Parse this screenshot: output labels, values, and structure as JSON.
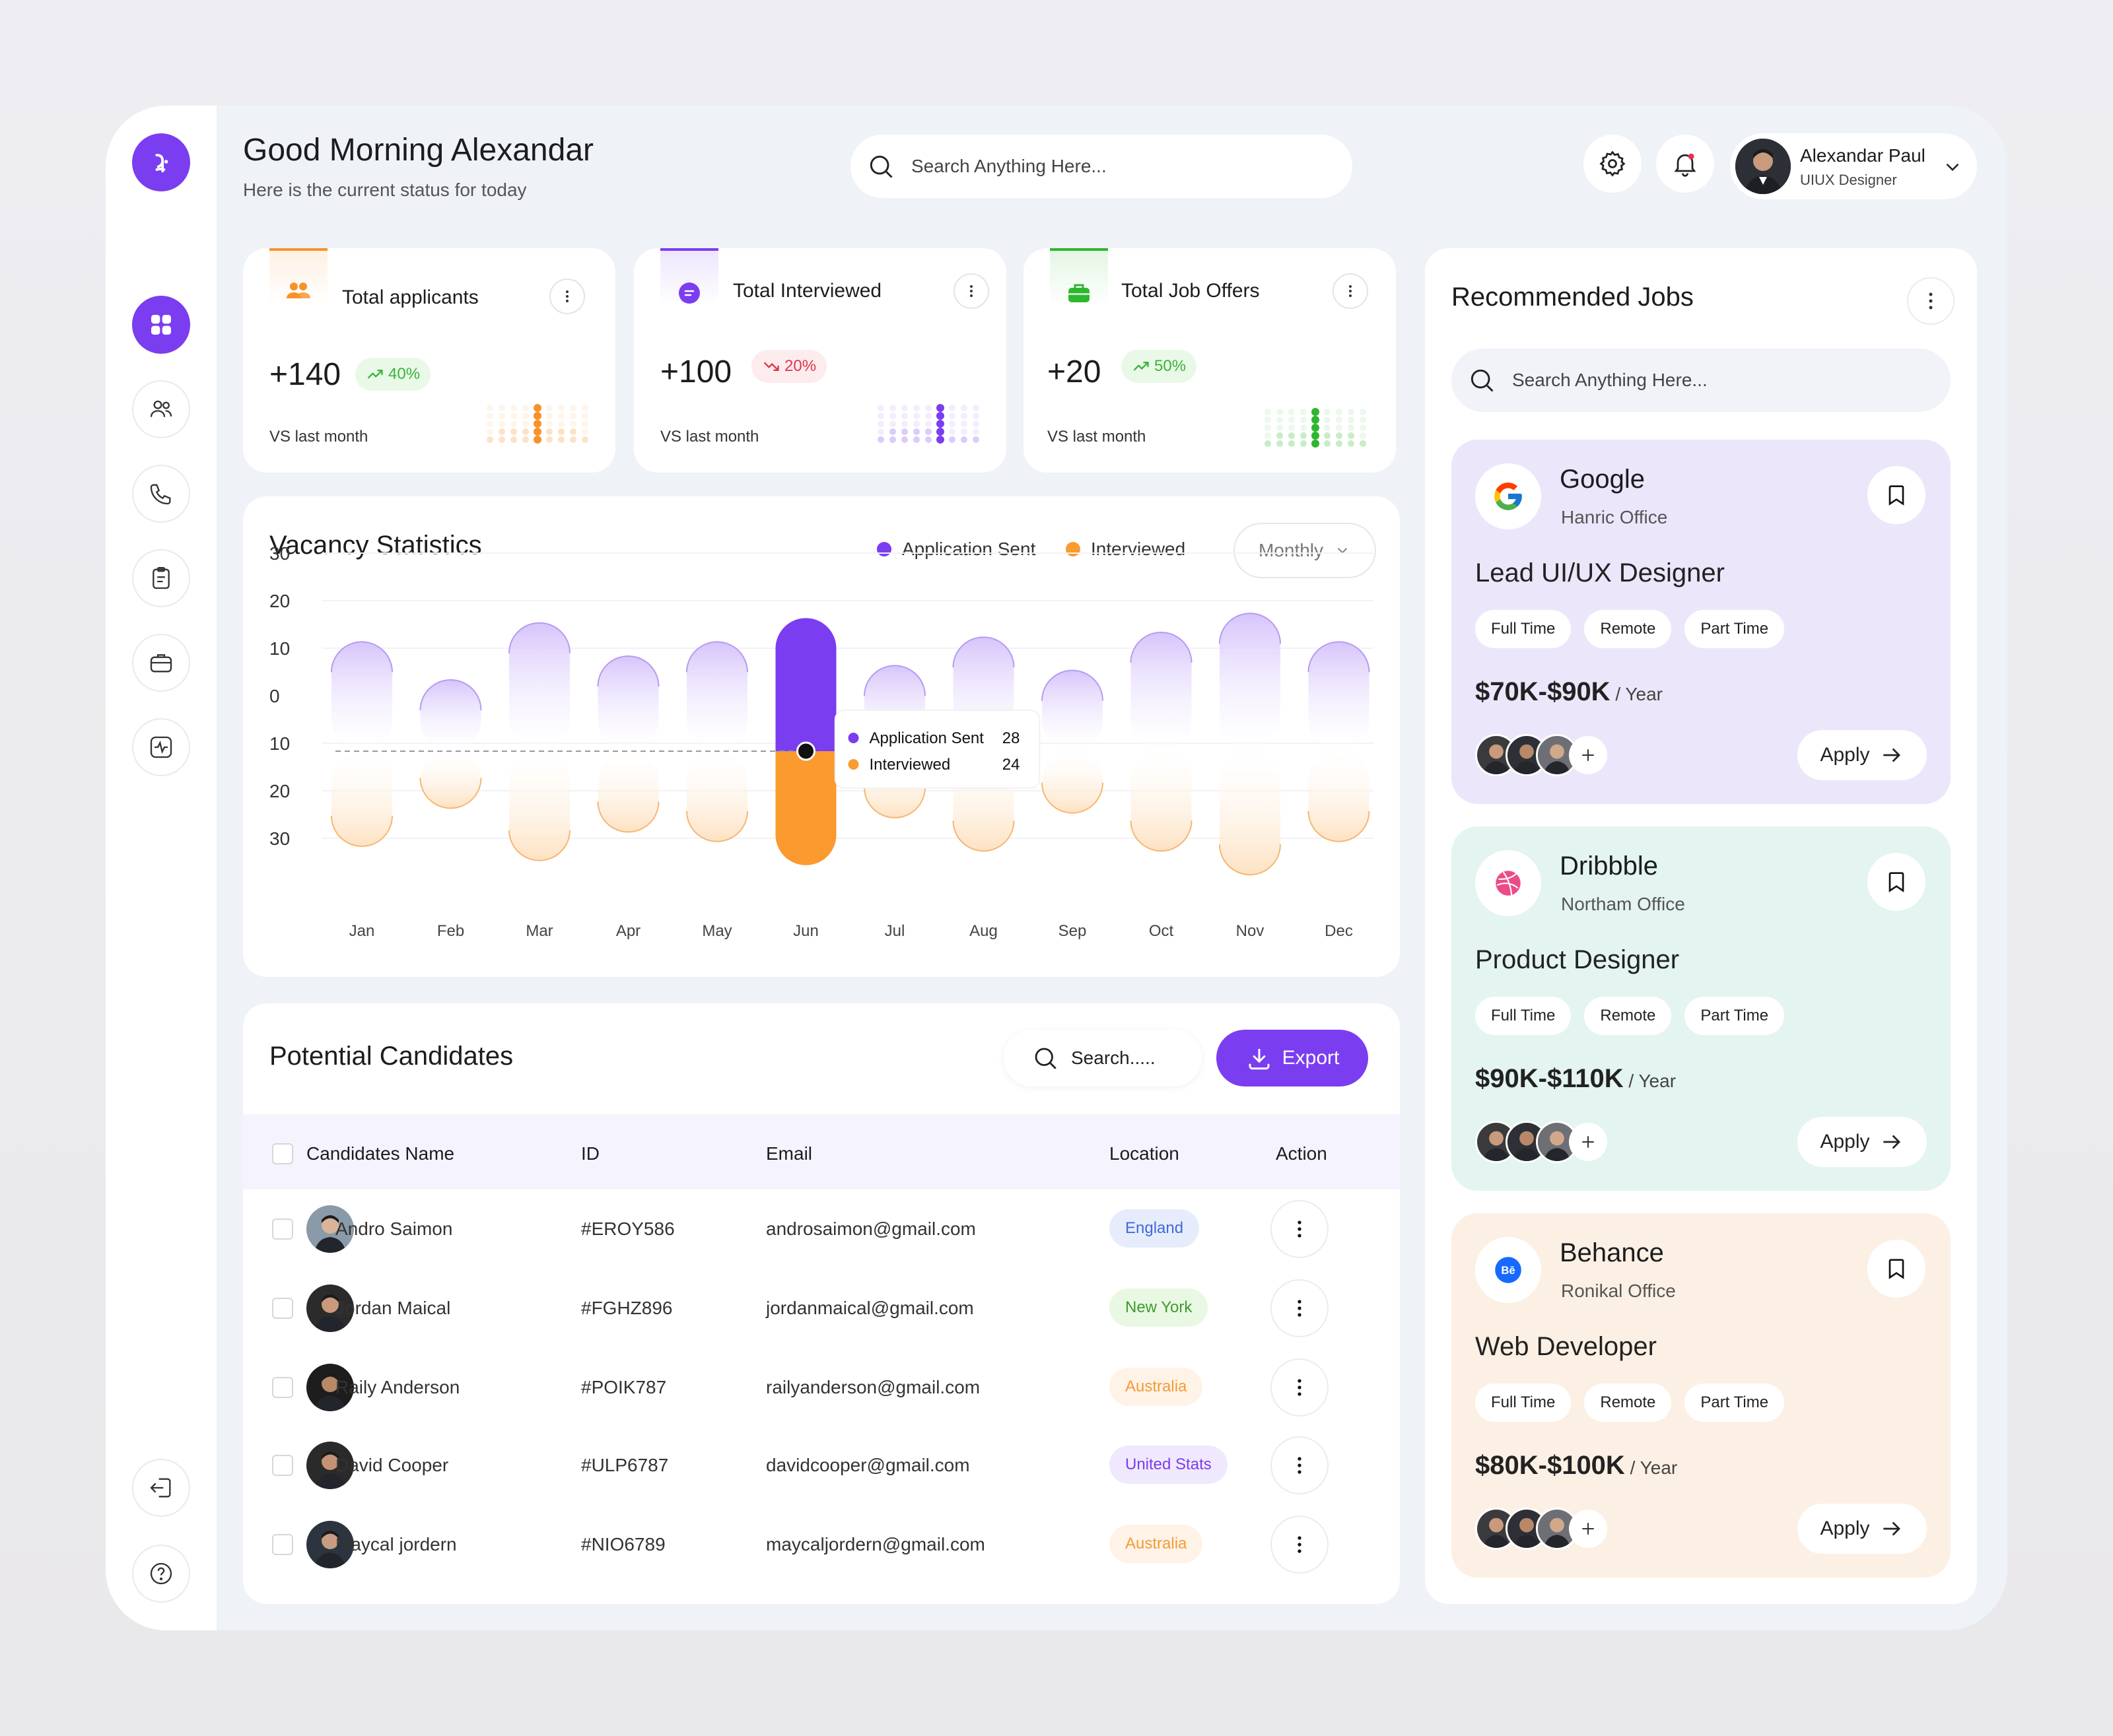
{
  "header": {
    "greeting": "Good Morning Alexandar",
    "subtitle": "Here is the current status for today",
    "search_placeholder": "Search Anything Here...",
    "user_name": "Alexandar Paul",
    "user_role": "UIUX Designer"
  },
  "sidebar": {
    "items": [
      {
        "icon": "dashboard-icon",
        "active": true
      },
      {
        "icon": "users-icon",
        "active": false
      },
      {
        "icon": "phone-icon",
        "active": false
      },
      {
        "icon": "clipboard-icon",
        "active": false
      },
      {
        "icon": "briefcase-icon",
        "active": false
      },
      {
        "icon": "activity-icon",
        "active": false
      }
    ],
    "bottom": [
      {
        "icon": "logout-icon"
      },
      {
        "icon": "help-icon"
      }
    ]
  },
  "stats": [
    {
      "label": "Total applicants",
      "value": "+140",
      "change": "40%",
      "trend": "up",
      "foot": "VS last month",
      "color": "#f7922a",
      "icon": "users-icon"
    },
    {
      "label": "Total Interviewed",
      "value": "+100",
      "change": "20%",
      "trend": "down",
      "foot": "VS last month",
      "color": "#7b3df0",
      "icon": "chat-icon"
    },
    {
      "label": "Total Job Offers",
      "value": "+20",
      "change": "50%",
      "trend": "up",
      "foot": "VS last month",
      "color": "#2fb62f",
      "icon": "briefcase-icon"
    }
  ],
  "vacancy": {
    "title": "Vacancy Statistics",
    "legend_sent": "Application Sent",
    "legend_interviewed": "Interviewed",
    "period": "Monthly",
    "tooltip": {
      "sent_label": "Application Sent",
      "sent_value": "28",
      "interviewed_label": "Interviewed",
      "interviewed_value": "24"
    }
  },
  "chart_data": {
    "type": "bar",
    "title": "Vacancy Statistics",
    "categories": [
      "Jan",
      "Feb",
      "Mar",
      "Apr",
      "May",
      "Jun",
      "Jul",
      "Aug",
      "Sep",
      "Oct",
      "Nov",
      "Dec"
    ],
    "y_ticks": [
      "30",
      "20",
      "10",
      "0",
      "10",
      "20",
      "30"
    ],
    "ylim": [
      -30,
      30
    ],
    "highlight_index": 5,
    "series": [
      {
        "name": "Application Sent",
        "color": "#7b3df0",
        "direction": "up",
        "values": [
          23,
          15,
          27,
          20,
          23,
          28,
          18,
          24,
          17,
          25,
          29,
          23
        ]
      },
      {
        "name": "Interviewed",
        "color": "#fb9a2f",
        "direction": "down",
        "values": [
          20,
          12,
          23,
          17,
          19,
          24,
          14,
          21,
          13,
          21,
          26,
          19
        ]
      }
    ]
  },
  "candidates": {
    "title": "Potential Candidates",
    "search_label": "Search.....",
    "export_label": "Export",
    "columns": [
      "Candidates Name",
      "ID",
      "Email",
      "Location",
      "Action"
    ],
    "rows": [
      {
        "name": "Andro Saimon",
        "id": "#EROY586",
        "email": "androsaimon@gmail.com",
        "location": "England",
        "loc_color": "#3f6ad8",
        "loc_bg": "#e6ecfb"
      },
      {
        "name": "Jordan Maical",
        "id": "#FGHZ896",
        "email": "jordanmaical@gmail.com",
        "location": "New York",
        "loc_color": "#3f9a2f",
        "loc_bg": "#e9f8e3"
      },
      {
        "name": "Raily Anderson",
        "id": "#POIK787",
        "email": "railyanderson@gmail.com",
        "location": "Australia",
        "loc_color": "#f29b38",
        "loc_bg": "#fff3e7"
      },
      {
        "name": "David Cooper",
        "id": "#ULP6787",
        "email": "davidcooper@gmail.com",
        "location": "United Stats",
        "loc_color": "#7b3df0",
        "loc_bg": "#f0e9fd"
      },
      {
        "name": "Maycal jordern",
        "id": "#NIO6789",
        "email": "maycaljordern@gmail.com",
        "location": "Australia",
        "loc_color": "#f29b38",
        "loc_bg": "#fff3e7"
      }
    ]
  },
  "recommended": {
    "title": "Recommended Jobs",
    "search_placeholder": "Search Anything Here...",
    "jobs": [
      {
        "company": "Google",
        "office": "Hanric Office",
        "title": "Lead UI/UX Designer",
        "tags": [
          "Full Time",
          "Remote",
          "Part Time"
        ],
        "salary": "$70K-$90K",
        "period": "/ Year",
        "apply": "Apply",
        "bg": "#ece6fb",
        "logo": "google-logo-icon"
      },
      {
        "company": "Dribbble",
        "office": "Northam Office",
        "title": "Product Designer",
        "tags": [
          "Full Time",
          "Remote",
          "Part Time"
        ],
        "salary": "$90K-$110K",
        "period": "/ Year",
        "apply": "Apply",
        "bg": "#e3f4f1",
        "logo": "dribbble-logo-icon"
      },
      {
        "company": "Behance",
        "office": "Ronikal Office",
        "title": "Web Developer",
        "tags": [
          "Full Time",
          "Remote",
          "Part Time"
        ],
        "salary": "$80K-$100K",
        "period": "/ Year",
        "apply": "Apply",
        "bg": "#fcf0e4",
        "logo": "behance-logo-icon"
      }
    ]
  }
}
